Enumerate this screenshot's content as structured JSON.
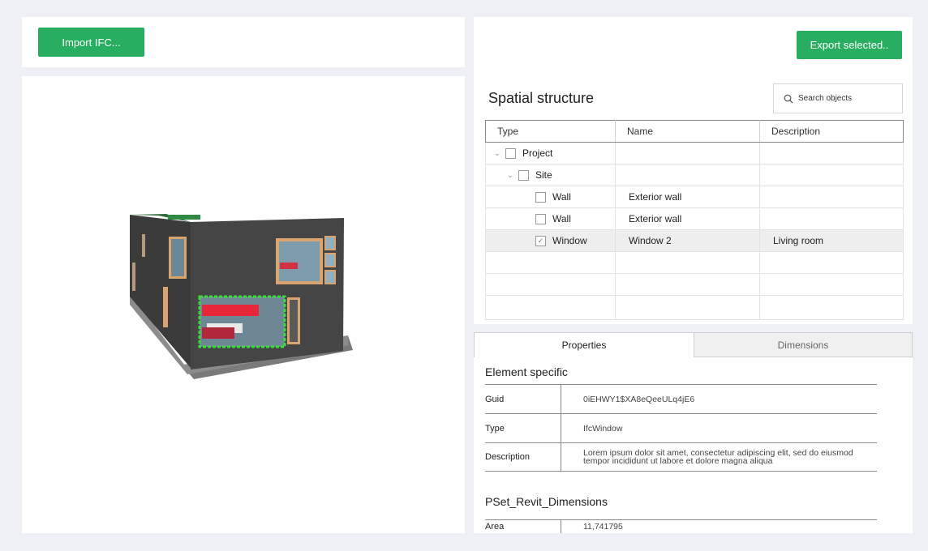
{
  "left": {
    "import_label": "Import IFC..."
  },
  "right": {
    "export_label": "Export selected..",
    "spatial_title": "Spatial structure",
    "search_placeholder": "Search objects",
    "columns": [
      "Type",
      "Name",
      "Description"
    ],
    "rows": [
      {
        "type": "Project",
        "name": "",
        "description": "",
        "level": 0,
        "expandable": true,
        "checked": false
      },
      {
        "type": "Site",
        "name": "",
        "description": "",
        "level": 1,
        "expandable": true,
        "checked": false
      },
      {
        "type": "Wall",
        "name": "Exterior wall",
        "description": "",
        "level": 2,
        "expandable": false,
        "checked": false
      },
      {
        "type": "Wall",
        "name": "Exterior wall",
        "description": "",
        "level": 2,
        "expandable": false,
        "checked": false
      },
      {
        "type": "Window",
        "name": "Window 2",
        "description": "Living room",
        "level": 2,
        "expandable": false,
        "checked": true,
        "selected": true
      }
    ],
    "empty_rows": 3,
    "tabs": [
      "Properties",
      "Dimensions"
    ],
    "active_tab": 0,
    "element_title": "Element specific",
    "properties": [
      {
        "key": "Guid",
        "value": "0iEHWY1$XA8eQeeULq4jE6"
      },
      {
        "key": "Type",
        "value": "IfcWindow"
      },
      {
        "key": "Description",
        "value": "Lorem ipsum dolor sit amet, consectetur adipiscing elit, sed do eiusmod tempor incididunt ut labore et dolore magna aliqua"
      }
    ],
    "pset_title": "PSet_Revit_Dimensions",
    "pset_properties": [
      {
        "key": "Area",
        "value": "11,741795"
      }
    ]
  },
  "colors": {
    "accent": "#27ae60",
    "background": "#eef0f6",
    "selection_highlight": "#3ddc3d"
  }
}
